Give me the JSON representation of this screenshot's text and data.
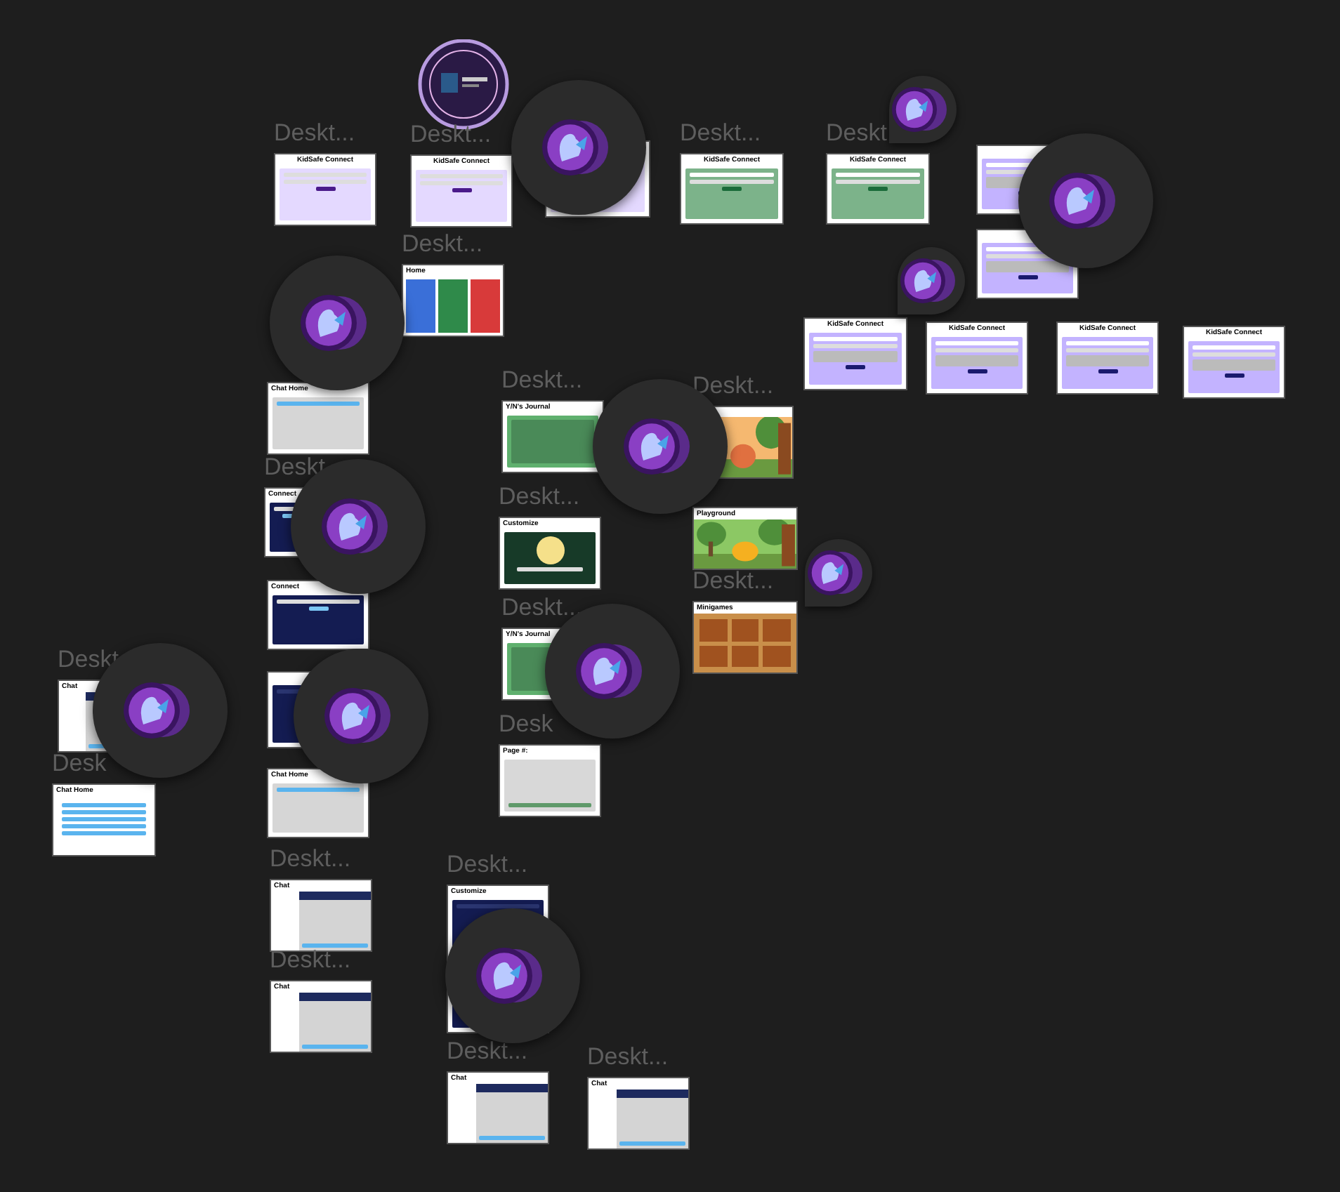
{
  "canvas": {
    "frames": [
      {
        "label": "Deskt...",
        "title": "KidSafe Connect",
        "kind": "login"
      },
      {
        "label": "Deskt...",
        "title": "KidSafe Connect",
        "kind": "login"
      },
      {
        "kind": "login"
      },
      {
        "label": "Deskt...",
        "title": "KidSafe Connect",
        "kind": "verify"
      },
      {
        "label": "Deskt",
        "title": "KidSafe Connect",
        "kind": "verify"
      },
      {
        "kind": "setup"
      },
      {
        "kind": "setup"
      },
      {
        "title": "KidSafe Connect",
        "kind": "setup"
      },
      {
        "title": "KidSafe Connect",
        "kind": "setup"
      },
      {
        "title": "KidSafe Connect",
        "kind": "setup"
      },
      {
        "title": "KidSafe Connect",
        "kind": "setup"
      },
      {
        "label": "Deskt...",
        "title": "Home",
        "kind": "home"
      },
      {
        "title": "Chat Home",
        "kind": "chat_home"
      },
      {
        "label": "Deskt",
        "title": "Connect",
        "kind": "connect"
      },
      {
        "title": "Connect",
        "kind": "connect"
      },
      {
        "kind": "customize"
      },
      {
        "title": "Chat Home",
        "kind": "chat_home"
      },
      {
        "label": "Deskt...",
        "title": "Chat",
        "kind": "chat"
      },
      {
        "label": "Deskt...",
        "title": "Chat",
        "kind": "chat"
      },
      {
        "label": "Deskt...",
        "title": "Y/N's Journal",
        "kind": "journal"
      },
      {
        "label": "Deskt...",
        "title": "Customize",
        "kind": "studio"
      },
      {
        "label": "Deskt...",
        "title": "Y/N's Journal",
        "kind": "journal"
      },
      {
        "label": "Desk",
        "title": "Page #:",
        "kind": "page"
      },
      {
        "label": "Deskt...",
        "kind": "outfits"
      },
      {
        "title": "Playground",
        "kind": "playground"
      },
      {
        "label": "Deskt...",
        "title": "Minigames",
        "kind": "minigames"
      },
      {
        "label": "Deskt",
        "title": "Chat",
        "kind": "chat"
      },
      {
        "label": "Desk",
        "title": "Chat Home",
        "kind": "chat_list"
      },
      {
        "label": "Deskt...",
        "title": "Customize",
        "kind": "customize"
      },
      {
        "label": "Deskt...",
        "title": "Chat",
        "kind": "chat"
      },
      {
        "label": "Deskt...",
        "title": "Chat",
        "kind": "chat"
      }
    ]
  }
}
